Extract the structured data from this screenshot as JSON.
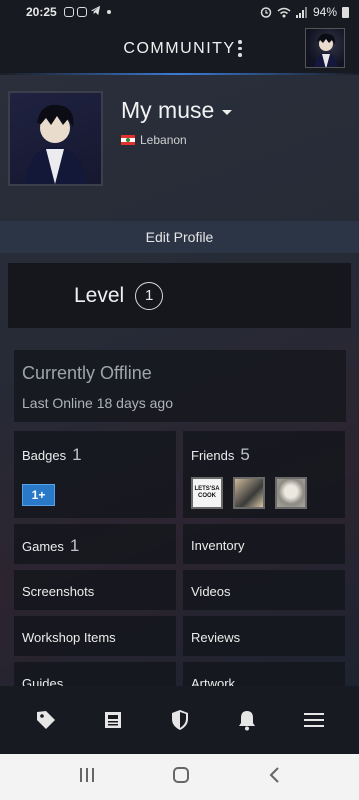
{
  "status_bar": {
    "time": "20:25",
    "battery": "94%"
  },
  "header": {
    "title": "COMMUNITY"
  },
  "profile": {
    "name": "My muse",
    "country": "Lebanon",
    "edit_label": "Edit Profile"
  },
  "level": {
    "label": "Level",
    "value": "1"
  },
  "presence": {
    "status": "Currently Offline",
    "last_online": "Last Online 18 days ago"
  },
  "tiles": {
    "badges": {
      "label": "Badges",
      "count": "1",
      "badge_text": "1+"
    },
    "friends": {
      "label": "Friends",
      "count": "5",
      "thumb_text": "LETS'SA COOK"
    },
    "games": {
      "label": "Games",
      "count": "1"
    },
    "inventory": {
      "label": "Inventory"
    },
    "screenshots": {
      "label": "Screenshots"
    },
    "videos": {
      "label": "Videos"
    },
    "workshop": {
      "label": "Workshop Items"
    },
    "reviews": {
      "label": "Reviews"
    },
    "guides": {
      "label": "Guides"
    },
    "artwork": {
      "label": "Artwork"
    }
  },
  "bottom_nav": [
    "tag-icon",
    "news-icon",
    "shield-icon",
    "bell-icon",
    "menu-icon"
  ],
  "colors": {
    "accent": "#3b7bd6",
    "badge_blue": "#2a78c8",
    "background": "#1b1d24"
  }
}
